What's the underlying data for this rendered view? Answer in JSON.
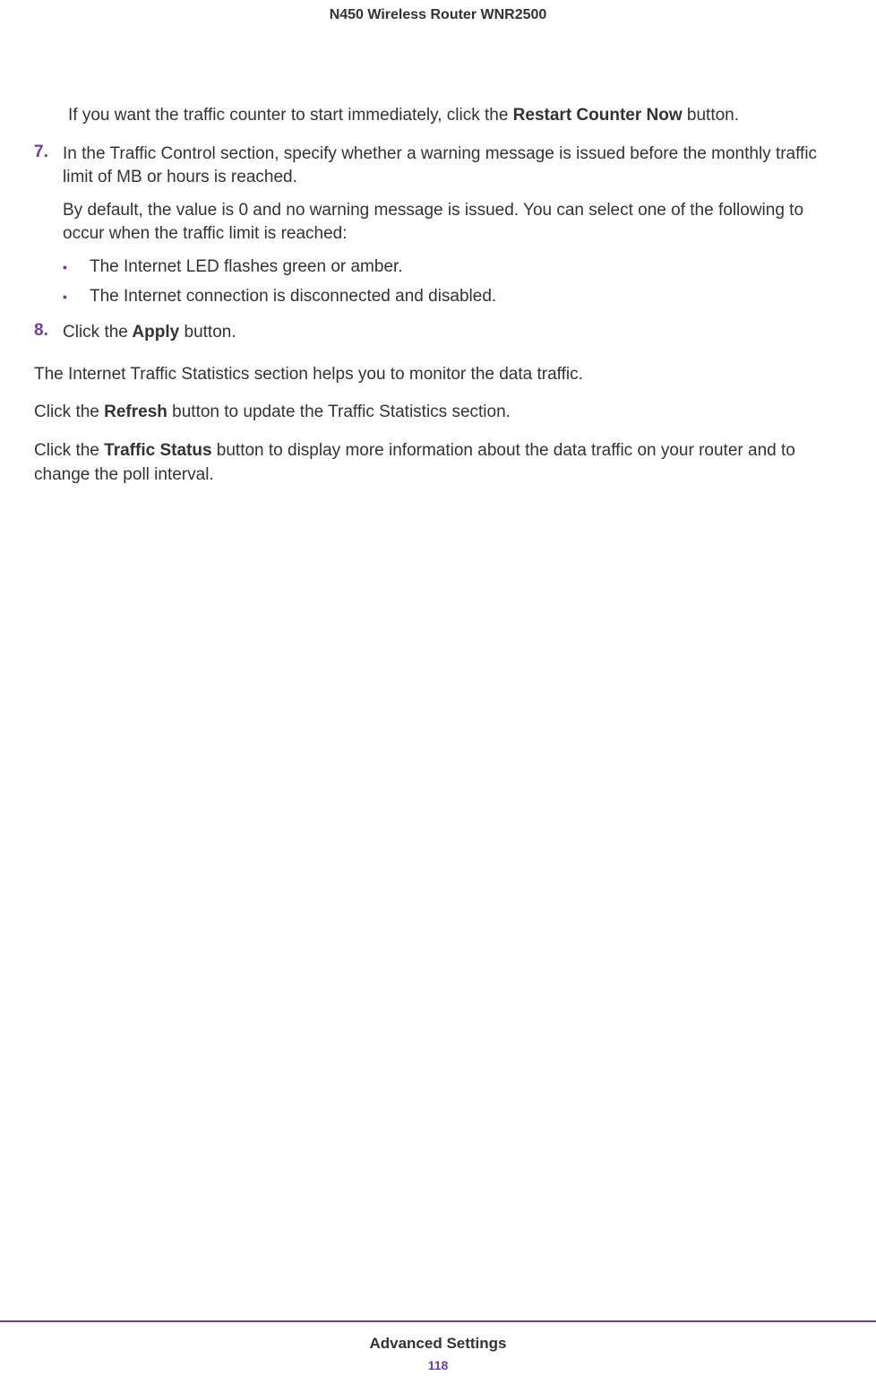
{
  "header": {
    "title": "N450 Wireless Router WNR2500"
  },
  "body": {
    "intro_para_before": "If you want the traffic counter to start immediately, click the ",
    "intro_para_bold": "Restart Counter Now",
    "intro_para_after": " button.",
    "step7_num": "7.",
    "step7_p1_a": "In the",
    "step7_p1_b": " Traffic Control section, specify whether a warning message is issued before the monthly traffic limit of MB or hours is reached.",
    "step7_p2": "By default, the value is 0 and no warning message is issued. You can select one of the following to occur when the traffic limit is reached:",
    "step7_bullet1": "The Internet LED flashes green or amber.",
    "step7_bullet2": "The Internet connection is disconnected and disabled.",
    "step8_num": "8.",
    "step8_before": "Click the",
    "step8_bold": " Apply",
    "step8_after": " button.",
    "para_stats": "The Internet Traffic Statistics section helps you to monitor the data traffic.",
    "para_refresh_before": "Click the ",
    "para_refresh_bold": "Refresh",
    "para_refresh_after": " button to update the Traffic Statistics section.",
    "para_status_before": "Click the ",
    "para_status_bold": "Traffic Status",
    "para_status_after": " button to display more information about the data traffic on your router and to change the poll interval."
  },
  "footer": {
    "section": "Advanced Settings",
    "page": "118"
  },
  "bullet_char": "•"
}
